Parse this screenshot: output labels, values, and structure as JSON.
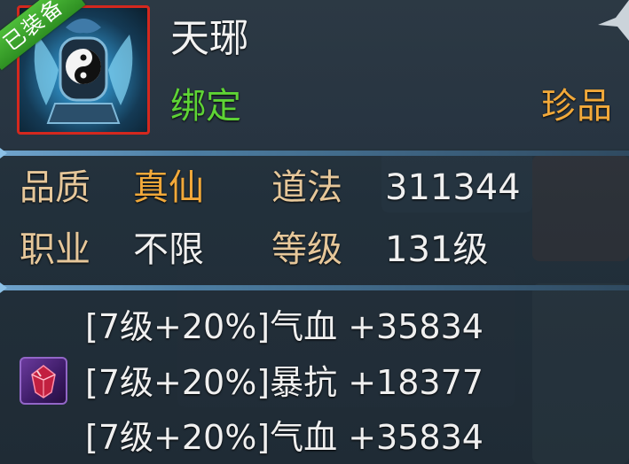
{
  "item": {
    "name": "天琊",
    "bind_status": "绑定",
    "rarity": "珍品",
    "equipped_badge": "已装备"
  },
  "attributes": {
    "quality_label": "品质",
    "quality_value": "真仙",
    "daofa_label": "道法",
    "daofa_value": "311344",
    "class_label": "职业",
    "class_value": "不限",
    "level_label": "等级",
    "level_value": "131级"
  },
  "gems": [
    {
      "text": "[7级+20%]气血 +35834"
    },
    {
      "text": "[7级+20%]暴抗 +18377"
    },
    {
      "text": "[7级+20%]气血 +35834"
    }
  ],
  "colors": {
    "bind_green": "#5ed335",
    "rarity_orange": "#f2a93a",
    "label_tan": "#e6c79a",
    "icon_border_red": "#d4281e",
    "badge_green": "#3fa82e"
  },
  "icons": {
    "item": "taiji-artifact-icon",
    "gem": "purple-gem-icon"
  }
}
